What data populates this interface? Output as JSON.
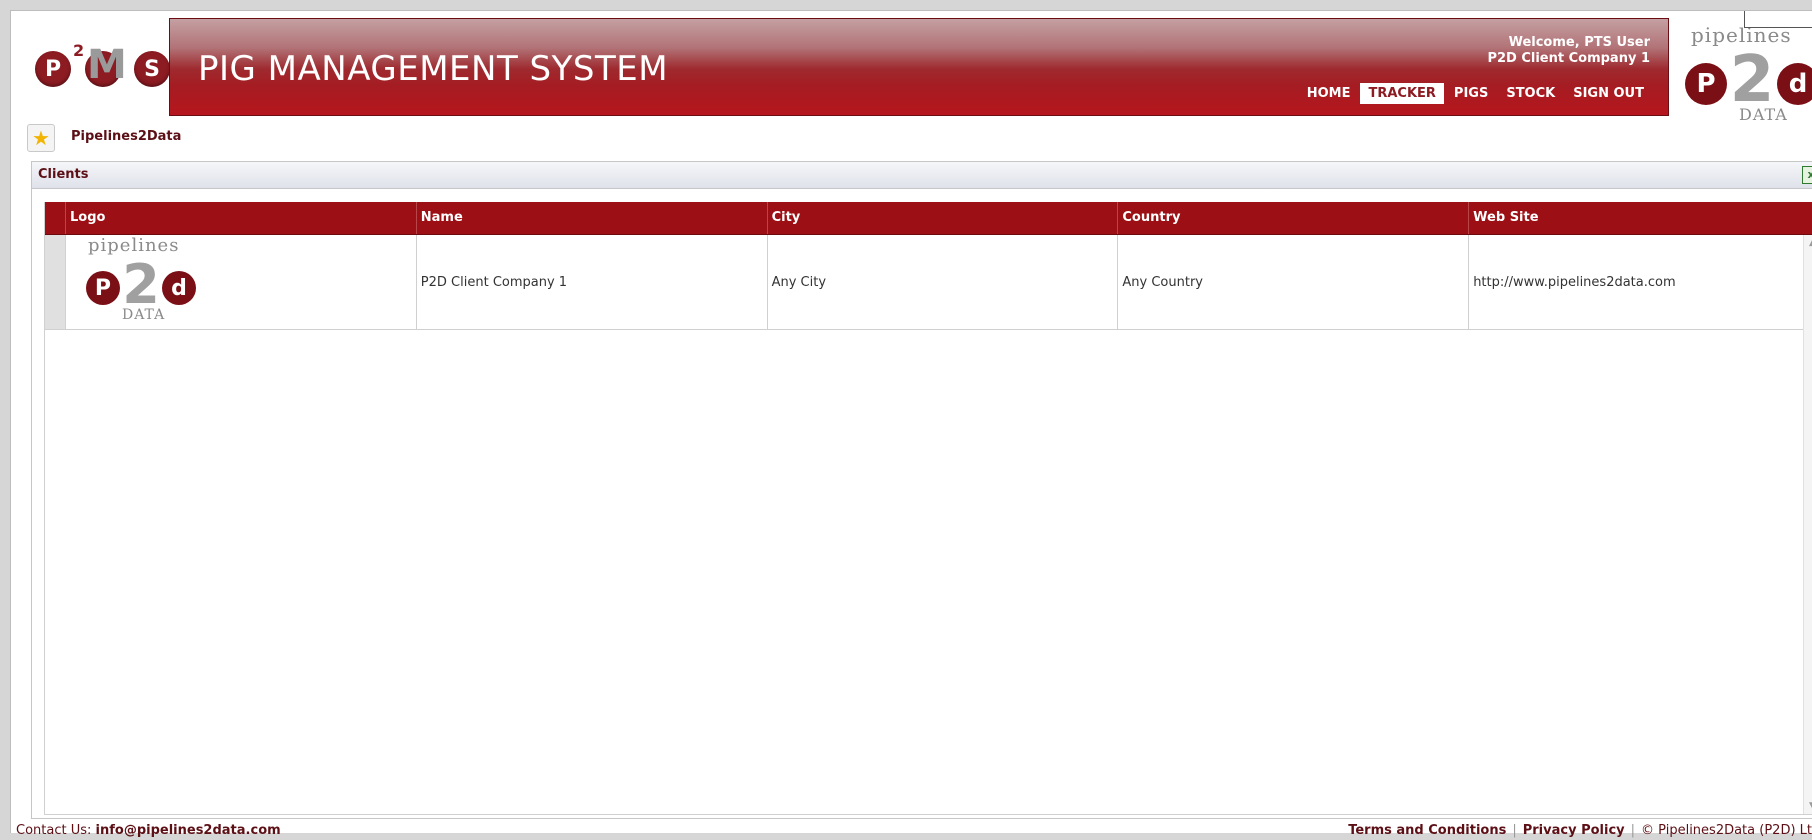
{
  "header": {
    "title": "PIG MANAGEMENT SYSTEM",
    "welcome_line1": "Welcome, PTS User",
    "welcome_line2": "P2D Client Company 1",
    "nav": [
      {
        "label": "HOME"
      },
      {
        "label": "TRACKER",
        "active": true
      },
      {
        "label": "PIGS"
      },
      {
        "label": "STOCK"
      },
      {
        "label": "SIGN OUT"
      }
    ]
  },
  "logos": {
    "pms": {
      "p": "P",
      "sup": "2",
      "m": "M",
      "s": "S"
    },
    "p2d": {
      "top": "pipelines",
      "left": "P",
      "middle": "2",
      "right": "d",
      "bottom": "DATA"
    }
  },
  "breadcrumb": {
    "label": "Pipelines2Data",
    "icon": "star-icon"
  },
  "panel": {
    "title": "Clients",
    "export_icon": "excel-export-icon",
    "columns": [
      "Logo",
      "Name",
      "City",
      "Country",
      "Web Site"
    ],
    "rows": [
      {
        "logo": {
          "top": "pipelines",
          "left": "P",
          "middle": "2",
          "right": "d",
          "bottom": "DATA"
        },
        "name": "P2D Client Company 1",
        "city": "Any City",
        "country": "Any Country",
        "website": "http://www.pipelines2data.com"
      }
    ]
  },
  "footer": {
    "contact_label": "Contact Us:",
    "contact_email": "info@pipelines2data.com",
    "terms": "Terms and Conditions",
    "privacy": "Privacy Policy",
    "copyright": "© Pipelines2Data (P2D) Lt"
  },
  "colors": {
    "brand": "#9c0f14",
    "brand_dark": "#5c1016",
    "header_grey": "#b27377"
  }
}
